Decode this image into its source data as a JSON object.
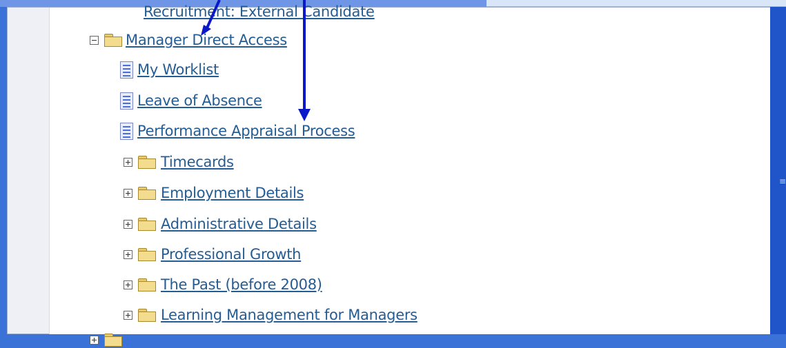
{
  "tree": {
    "top_partial": "Recruitment: External Candidate",
    "root": {
      "label": "Manager Direct Access",
      "expanded": true
    },
    "pages": [
      {
        "label": "My Worklist",
        "icon": "page-icon"
      },
      {
        "label": "Leave of Absence",
        "icon": "page-icon"
      },
      {
        "label": "Performance Appraisal Process",
        "icon": "page-icon"
      }
    ],
    "folders": [
      {
        "label": "Timecards",
        "icon": "folder-icon"
      },
      {
        "label": "Employment Details",
        "icon": "folder-icon"
      },
      {
        "label": "Administrative Details",
        "icon": "folder-icon"
      },
      {
        "label": "Professional Growth",
        "icon": "folder-icon"
      },
      {
        "label": "The Past (before 2008)",
        "icon": "folder-icon"
      },
      {
        "label": "Learning Management for Managers",
        "icon": "folder-icon"
      }
    ]
  },
  "colors": {
    "link": "#245c94",
    "arrow": "#0a18c8",
    "background": "#3a72d8"
  }
}
